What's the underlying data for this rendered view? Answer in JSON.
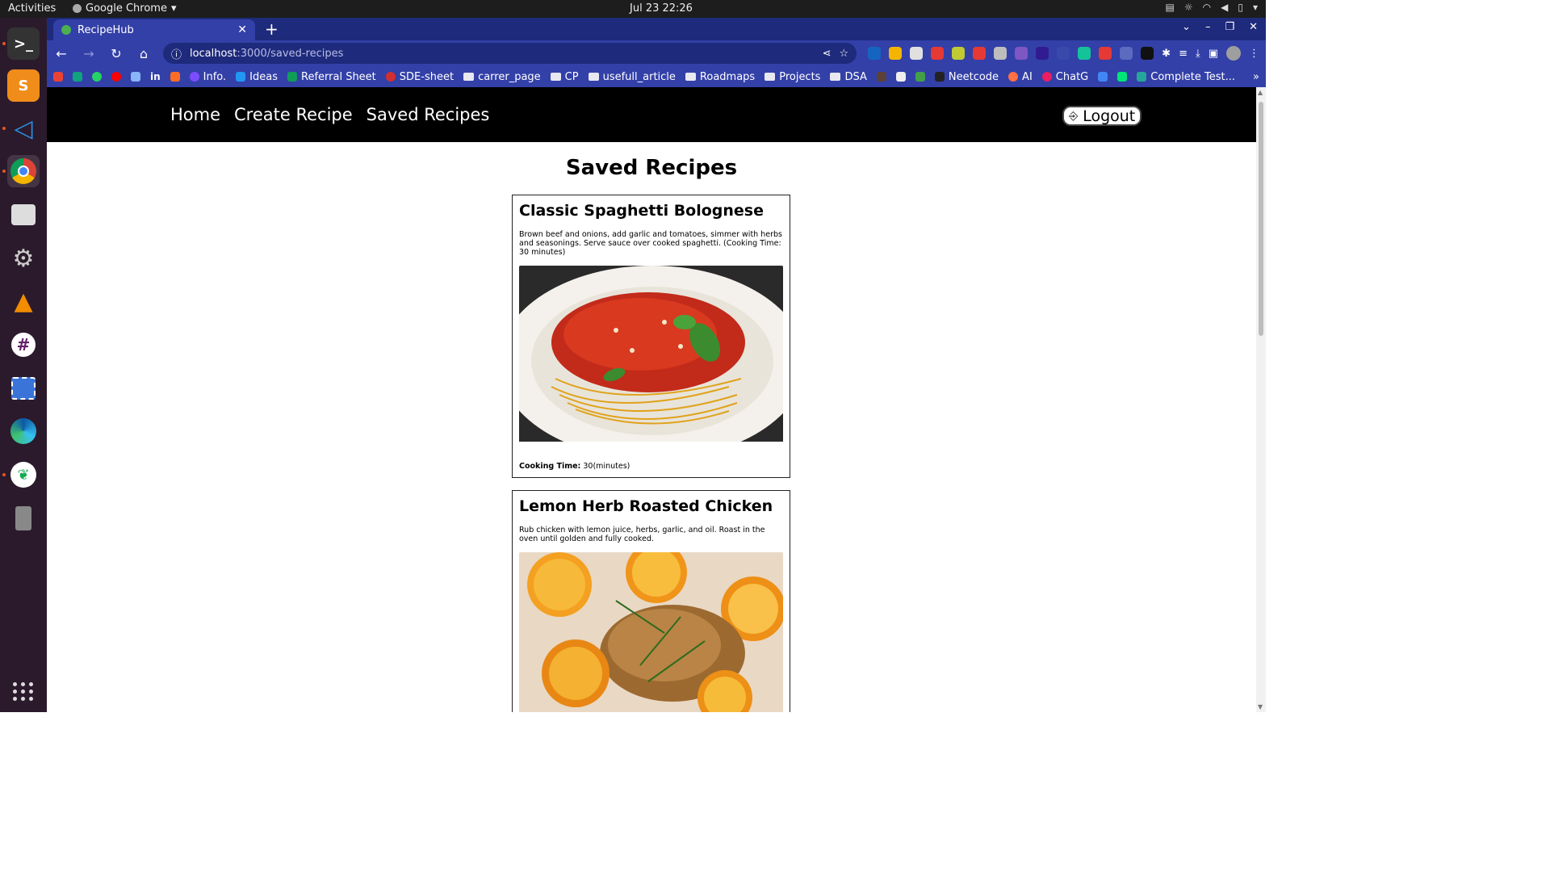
{
  "desktop": {
    "activities": "Activities",
    "app_menu": "Google Chrome",
    "clock": "Jul 23  22:26"
  },
  "browser": {
    "tab_title": "RecipeHub",
    "url_host": "localhost",
    "url_path": ":3000/saved-recipes",
    "bookmarks": [
      "Info.",
      "Ideas",
      "Referral Sheet",
      "SDE-sheet",
      "carrer_page",
      "CP",
      "usefull_article",
      "Roadmaps",
      "Projects",
      "DSA",
      "Neetcode",
      "AI",
      "ChatG",
      "Complete Test..."
    ]
  },
  "app": {
    "nav": {
      "home": "Home",
      "create": "Create Recipe",
      "saved": "Saved Recipes",
      "logout": "Logout"
    },
    "page_title": "Saved Recipes",
    "cooking_time_label": "Cooking Time:",
    "recipes": [
      {
        "name": "Classic Spaghetti Bolognese",
        "instructions": "Brown beef and onions, add garlic and tomatoes, simmer with herbs and seasonings. Serve sauce over cooked spaghetti. (Cooking Time: 30 minutes)",
        "cooking_time": "30(minutes)"
      },
      {
        "name": "Lemon Herb Roasted Chicken",
        "instructions": "Rub chicken with lemon juice, herbs, garlic, and oil. Roast in the oven until golden and fully cooked."
      }
    ]
  }
}
